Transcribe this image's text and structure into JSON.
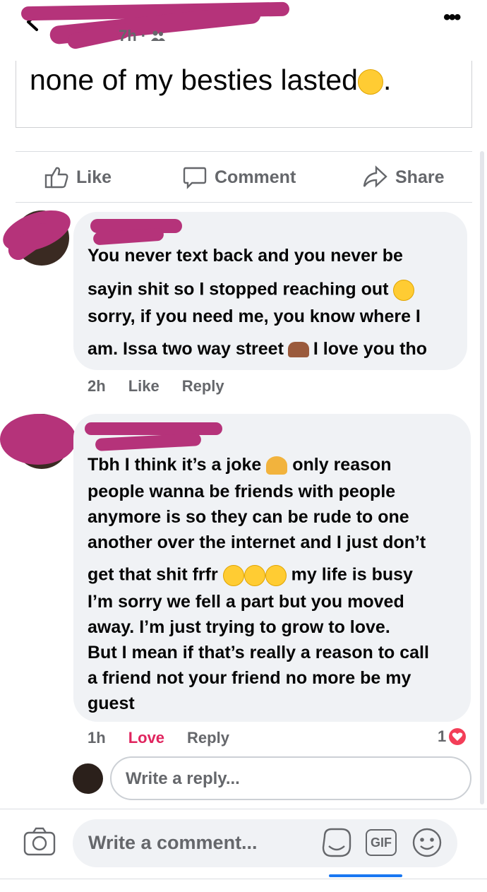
{
  "header": {
    "meta_text": "7h ·",
    "more_label": "•••"
  },
  "post": {
    "text": "none of my besties lasted"
  },
  "actions": {
    "like": "Like",
    "comment": "Comment",
    "share": "Share"
  },
  "comments": [
    {
      "lines": [
        "You never text back and you never be",
        "sayin shit so I stopped reaching out",
        "sorry, if you need me, you know where I",
        "am. Issa two way street",
        "I love you tho"
      ],
      "time": "2h",
      "like": "Like",
      "reply": "Reply"
    },
    {
      "lines": [
        "Tbh I think it’s a joke",
        "only reason",
        "people wanna be friends with people",
        "anymore is so they can be rude to one",
        "another over the internet and I just don’t",
        "get that shit frfr",
        "my life is busy",
        "I’m sorry we fell a part but you moved",
        "away.  I’m just trying to grow to love.",
        "But I mean if that’s really a reason to call",
        "a friend not your friend no more be my",
        "guest"
      ],
      "time": "1h",
      "love": "Love",
      "reply": "Reply",
      "reaction_count": "1"
    }
  ],
  "reply_box": {
    "placeholder": "Write a reply..."
  },
  "comment_box": {
    "placeholder": "Write a comment...",
    "gif_label": "GIF"
  },
  "colors": {
    "accent": "#1877f2",
    "love": "#e0245e",
    "bubble": "#f0f2f5",
    "redaction": "#b5337a"
  },
  "icons": [
    "back-icon",
    "friends-icon",
    "more-icon",
    "like-icon",
    "comment-icon",
    "share-icon",
    "heart-icon",
    "camera-icon",
    "sticker-icon",
    "gif-icon",
    "emoji-icon"
  ]
}
